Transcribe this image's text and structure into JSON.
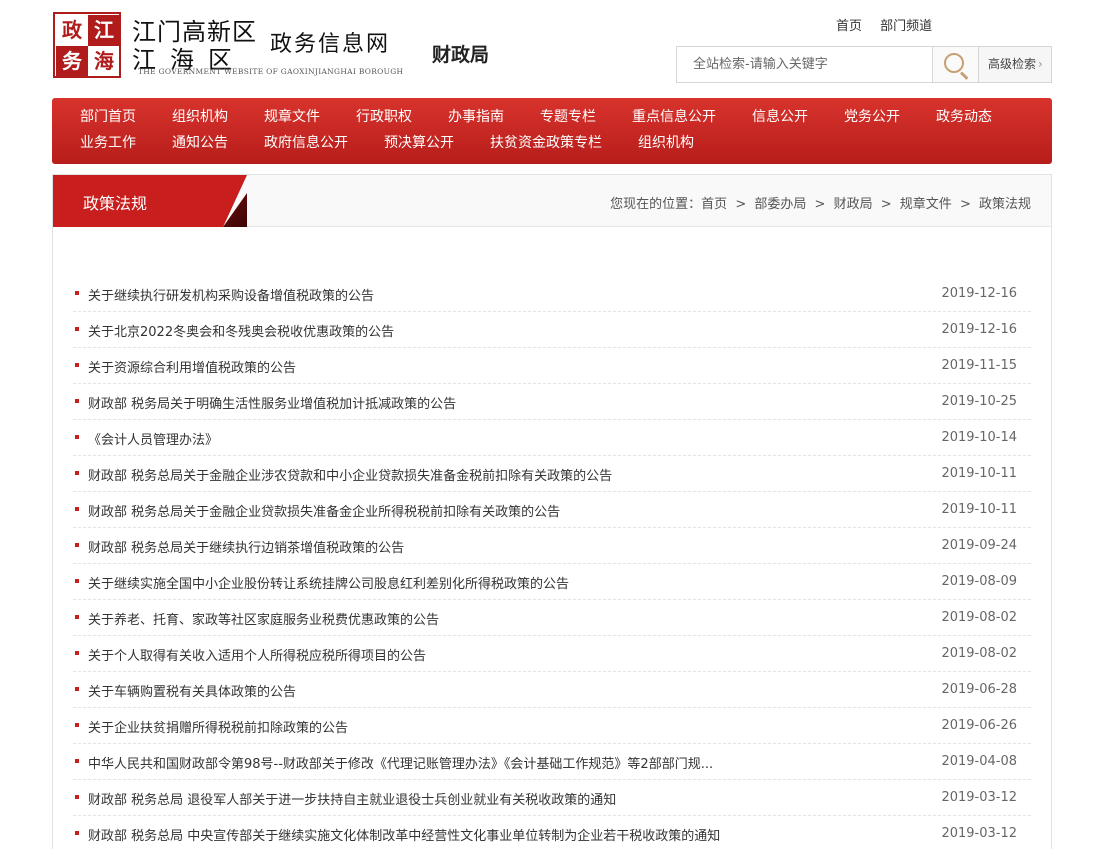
{
  "header": {
    "logo_seal": [
      "政",
      "江",
      "务",
      "海"
    ],
    "logo_line1": "江门高新区",
    "logo_line2": "江海区",
    "logo_site": "政务信息网",
    "logo_en": "THE GOVERNMENT WEBSITE OF GAOXINJIANGHAI BOROUGH",
    "dept_name": "财政局",
    "top_links": [
      "首页",
      "部门频道"
    ],
    "search_placeholder": "全站检索-请输入关键字",
    "search_icon": "search-icon",
    "advanced_search": "高级检索",
    "advanced_chevron": "›"
  },
  "nav": {
    "row1": [
      "部门首页",
      "组织机构",
      "规章文件",
      "行政职权",
      "办事指南",
      "专题专栏",
      "重点信息公开",
      "信息公开",
      "党务公开",
      "政务动态"
    ],
    "row2": [
      "业务工作",
      "通知公告",
      "政府信息公开",
      "预决算公开",
      "扶贫资金政策专栏",
      "组织机构"
    ],
    "colors": {
      "primary": "#c81e1e",
      "accent": "#b71d1a"
    }
  },
  "section": {
    "title": "政策法规",
    "breadcrumb_prefix": "您现在的位置：",
    "breadcrumb": [
      "首页",
      "部委办局",
      "财政局",
      "规章文件",
      "政策法规"
    ],
    "breadcrumb_sep": ">"
  },
  "articles": [
    {
      "title": "关于继续执行研发机构采购设备增值税政策的公告",
      "date": "2019-12-16"
    },
    {
      "title": "关于北京2022冬奥会和冬残奥会税收优惠政策的公告",
      "date": "2019-12-16"
    },
    {
      "title": "关于资源综合利用增值税政策的公告",
      "date": "2019-11-15"
    },
    {
      "title": "财政部 税务局关于明确生活性服务业增值税加计抵减政策的公告",
      "date": "2019-10-25"
    },
    {
      "title": "《会计人员管理办法》",
      "date": "2019-10-14"
    },
    {
      "title": "财政部 税务总局关于金融企业涉农贷款和中小企业贷款损失准备金税前扣除有关政策的公告",
      "date": "2019-10-11"
    },
    {
      "title": "财政部 税务总局关于金融企业贷款损失准备金企业所得税税前扣除有关政策的公告",
      "date": "2019-10-11"
    },
    {
      "title": "财政部 税务总局关于继续执行边销茶增值税政策的公告",
      "date": "2019-09-24"
    },
    {
      "title": "关于继续实施全国中小企业股份转让系统挂牌公司股息红利差别化所得税政策的公告",
      "date": "2019-08-09"
    },
    {
      "title": "关于养老、托育、家政等社区家庭服务业税费优惠政策的公告",
      "date": "2019-08-02"
    },
    {
      "title": "关于个人取得有关收入适用个人所得税应税所得项目的公告",
      "date": "2019-08-02"
    },
    {
      "title": "关于车辆购置税有关具体政策的公告",
      "date": "2019-06-28"
    },
    {
      "title": "关于企业扶贫捐赠所得税税前扣除政策的公告",
      "date": "2019-06-26"
    },
    {
      "title": "中华人民共和国财政部令第98号--财政部关于修改《代理记账管理办法》《会计基础工作规范》等2部部门规...",
      "date": "2019-04-08"
    },
    {
      "title": "财政部 税务总局 退役军人部关于进一步扶持自主就业退役士兵创业就业有关税收政策的通知",
      "date": "2019-03-12"
    },
    {
      "title": "财政部 税务总局 中央宣传部关于继续实施文化体制改革中经营性文化事业单位转制为企业若干税收政策的通知",
      "date": "2019-03-12"
    }
  ]
}
